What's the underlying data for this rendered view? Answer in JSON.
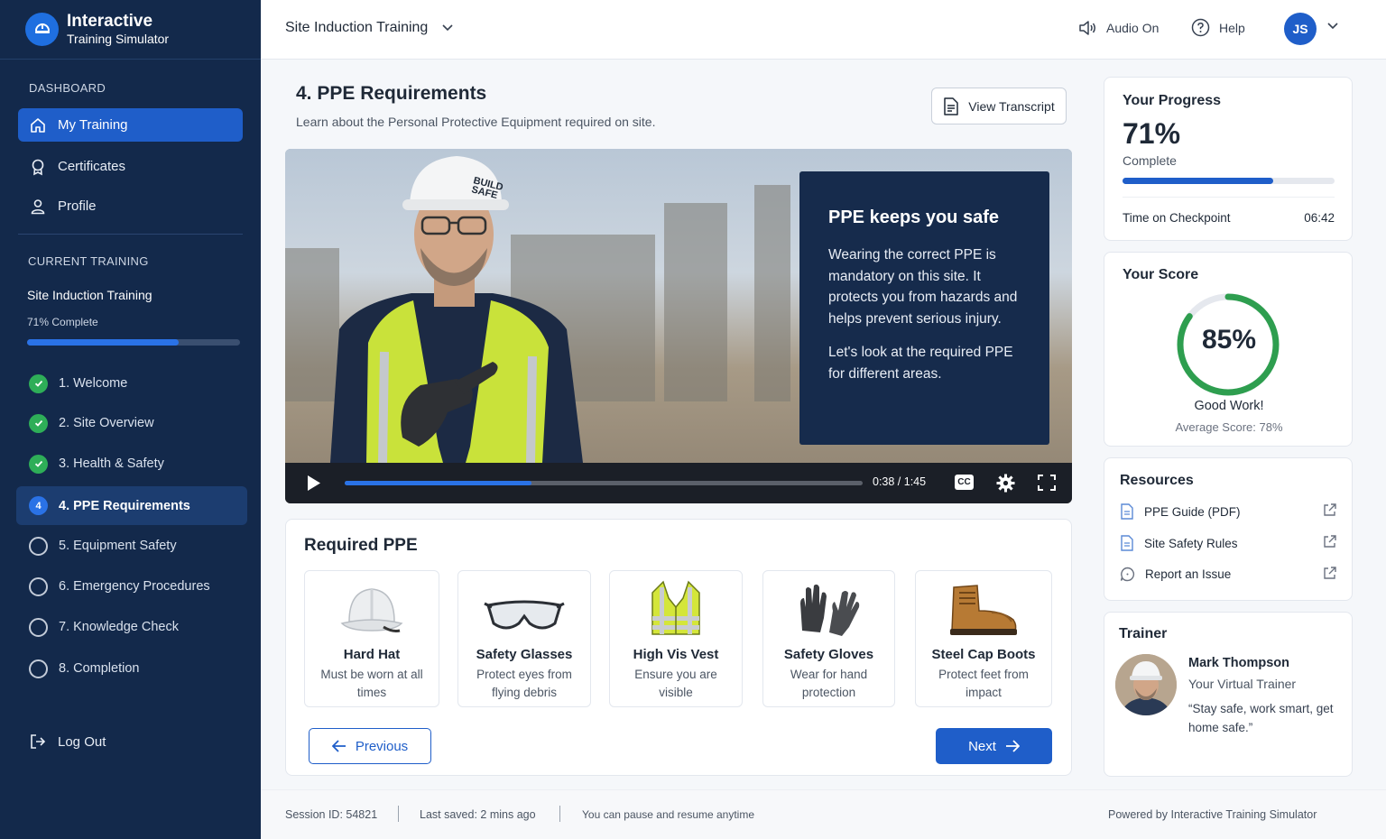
{
  "brand": {
    "title": "Interactive",
    "subtitle": "Training Simulator"
  },
  "sidebar": {
    "dashboard_label": "DASHBOARD",
    "nav": [
      {
        "label": "My Training",
        "icon": "home-icon"
      },
      {
        "label": "Certificates",
        "icon": "certificate-icon"
      },
      {
        "label": "Profile",
        "icon": "user-icon"
      }
    ],
    "current_label": "CURRENT TRAINING",
    "current_title": "Site Induction Training",
    "current_pct": "71% Complete",
    "current_progress": 0.71,
    "steps": [
      {
        "label": "1. Welcome",
        "status": "done"
      },
      {
        "label": "2. Site Overview",
        "status": "done"
      },
      {
        "label": "3. Health & Safety",
        "status": "done"
      },
      {
        "label": "4. PPE Requirements",
        "status": "current",
        "num": "4"
      },
      {
        "label": "5. Equipment Safety",
        "status": "todo"
      },
      {
        "label": "6. Emergency Procedures",
        "status": "todo"
      },
      {
        "label": "7. Knowledge Check",
        "status": "todo"
      },
      {
        "label": "8. Completion",
        "status": "todo"
      }
    ],
    "logout": "Log Out"
  },
  "topbar": {
    "title": "Site Induction Training",
    "audio": "Audio On",
    "help": "Help",
    "initials": "JS"
  },
  "main": {
    "title": "4. PPE Requirements",
    "subtitle": "Learn about the Personal Protective Equipment required on site.",
    "transcript_btn": "View Transcript",
    "video": {
      "helmet_text_1": "BUILD",
      "helmet_text_2": "SAFE",
      "caption_title": "PPE keeps you safe",
      "caption_p1": "Wearing the correct PPE is mandatory on this site. It protects you from hazards and helps prevent serious injury.",
      "caption_p2": "Let's look at the required PPE for different areas.",
      "time": "0:38 / 1:45",
      "progress": 0.36,
      "cc": "CC"
    },
    "ppe_title": "Required PPE",
    "ppe": [
      {
        "name": "Hard Hat",
        "desc": "Must be worn at all times",
        "icon": "hard-hat-icon"
      },
      {
        "name": "Safety Glasses",
        "desc": "Protect eyes from flying debris",
        "icon": "safety-glasses-icon"
      },
      {
        "name": "High Vis Vest",
        "desc": "Ensure you are visible",
        "icon": "high-vis-vest-icon"
      },
      {
        "name": "Safety Gloves",
        "desc": "Wear for hand protection",
        "icon": "gloves-icon"
      },
      {
        "name": "Steel Cap Boots",
        "desc": "Protect feet from impact",
        "icon": "boots-icon"
      }
    ],
    "prev": "Previous",
    "next": "Next"
  },
  "progress": {
    "title": "Your Progress",
    "pct": "71%",
    "label": "Complete",
    "value": 0.71,
    "time_label": "Time on Checkpoint",
    "time_value": "06:42"
  },
  "score": {
    "title": "Your Score",
    "pct": "85%",
    "value": 0.85,
    "message": "Good Work!",
    "average": "Average Score: 78%"
  },
  "resources": {
    "title": "Resources",
    "items": [
      {
        "label": "PPE Guide (PDF)",
        "icon": "document-icon"
      },
      {
        "label": "Site Safety Rules",
        "icon": "document-icon"
      },
      {
        "label": "Report an Issue",
        "icon": "chat-icon"
      }
    ]
  },
  "trainer": {
    "title": "Trainer",
    "name": "Mark Thompson",
    "role": "Your Virtual Trainer",
    "quote": "“Stay safe, work smart, get home safe.”"
  },
  "footer": {
    "session": "Session ID: 54821",
    "saved": "Last saved: 2 mins ago",
    "note": "You can pause and resume anytime",
    "powered": "Powered by Interactive Training Simulator"
  },
  "colors": {
    "sidebar": "#13294b",
    "accent": "#1f5ec9",
    "success": "#2eae58"
  }
}
